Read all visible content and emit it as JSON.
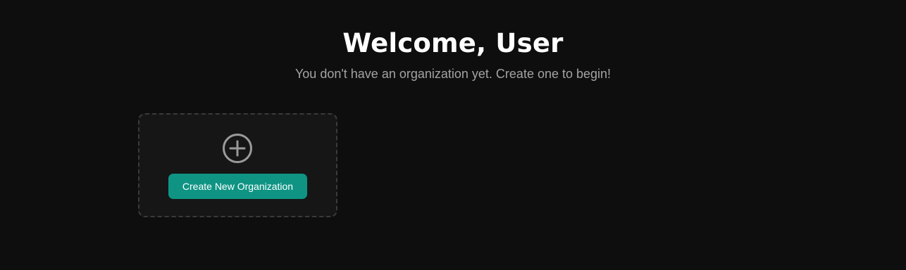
{
  "header": {
    "title": "Welcome, User",
    "subtitle": "You don't have an organization yet. Create one to begin!"
  },
  "create_card": {
    "icon": "plus-circle-icon",
    "button_label": "Create New Organization"
  },
  "colors": {
    "background": "#0e0e0e",
    "card_background": "#161616",
    "card_border": "#3a3a3a",
    "accent": "#0f9484",
    "title_text": "#ffffff",
    "subtitle_text": "#a3a3a3",
    "icon": "#9a9a9a"
  }
}
